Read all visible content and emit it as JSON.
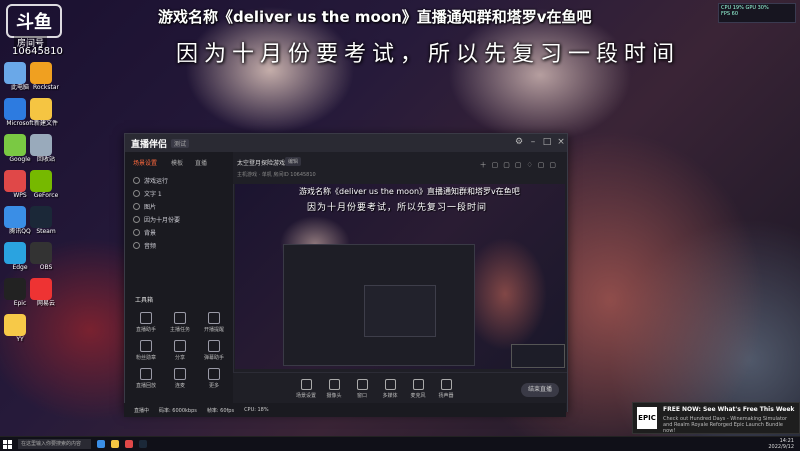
{
  "overlay": {
    "stream_title": "游戏名称《deliver us the moon》直播通知群和塔罗v在鱼吧",
    "notice": "因为十月份要考试，所以先复习一段时间"
  },
  "corner": {
    "logo": "斗鱼",
    "room_label": "房间号",
    "room_id": "10645810"
  },
  "desktop_icons": [
    {
      "label": "此电脑",
      "color": "#6aa8e8"
    },
    {
      "label": "Rockstar",
      "color": "#f0a020"
    },
    {
      "label": "Microsoft",
      "color": "#2d7be0"
    },
    {
      "label": "新建文件",
      "color": "#f5c542"
    },
    {
      "label": "Google",
      "color": "#7ac943"
    },
    {
      "label": "回收站",
      "color": "#9ab"
    },
    {
      "label": "WPS",
      "color": "#e04848"
    },
    {
      "label": "GeForce",
      "color": "#76b900"
    },
    {
      "label": "腾讯QQ",
      "color": "#3a8ee6"
    },
    {
      "label": "Steam",
      "color": "#1b2838"
    },
    {
      "label": "Edge",
      "color": "#2aa3e0"
    },
    {
      "label": "OBS",
      "color": "#333"
    },
    {
      "label": "Epic",
      "color": "#222"
    },
    {
      "label": "网易云",
      "color": "#e33"
    },
    {
      "label": "YY",
      "color": "#f7c948"
    }
  ],
  "stats_widget": {
    "line1": "CPU 19%  GPU 30%",
    "line2": "FPS 60"
  },
  "app": {
    "logo": "直播伴侣",
    "version": "测试",
    "sidebar_tabs": [
      "场景设置",
      "模板",
      "直播"
    ],
    "scenes": [
      "游戏运行",
      "文字 1",
      "图片",
      "因为十月份要",
      "背景",
      "音频"
    ],
    "tools_title": "工具箱",
    "tools": [
      "直播助手",
      "主播任务",
      "开播提醒",
      "粉丝勋章",
      "分享",
      "弹幕助手",
      "直播回放",
      "连麦",
      "更多"
    ],
    "header_title": "太空登月探险游戏",
    "header_edit": "编辑",
    "header_meta": "主机游戏 · 单机   房间ID 10645810",
    "preview_title": "游戏名称《deliver us the moon》直播通知群和塔罗v在鱼吧",
    "preview_notice": "因为十月份要考试，所以先复习一段时间",
    "bottom_items": [
      "场景设置",
      "摄像头",
      "窗口",
      "多媒体",
      "麦克风",
      "扬声器"
    ],
    "start_label": "结束直播",
    "status": [
      "直播中",
      "码率: 6000kbps",
      "帧率: 60fps",
      "CPU: 18%"
    ]
  },
  "toast": {
    "logo": "EPIC",
    "title": "FREE NOW: See What's Free This Week",
    "body": "Check out Hundred Days - Winemaking Simulator and Realm Royale Reforged Epic Launch Bundle now!"
  },
  "taskbar": {
    "search": "在这里输入你要搜索的内容",
    "time": "14:21",
    "date": "2022/9/12"
  }
}
